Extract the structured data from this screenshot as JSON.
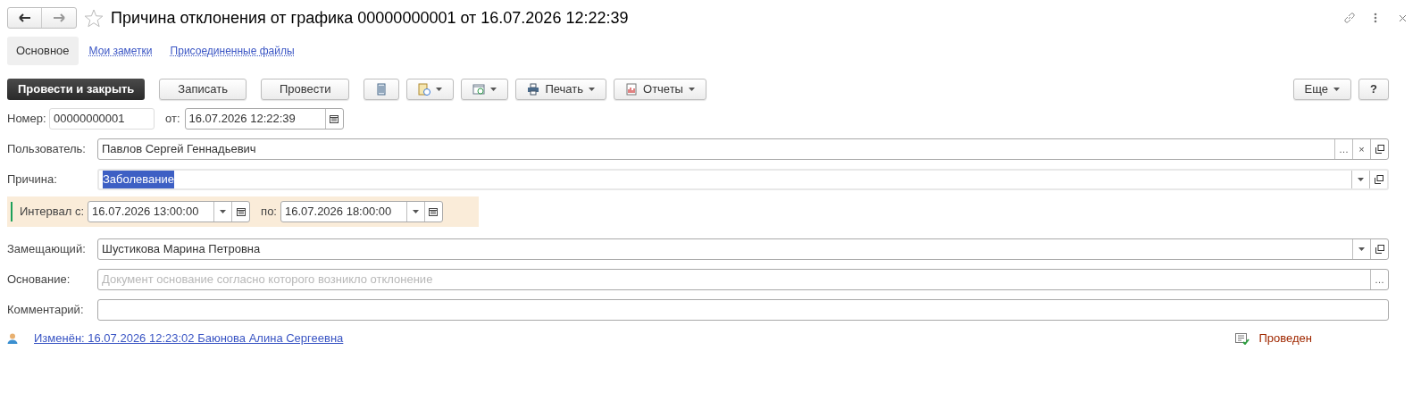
{
  "window": {
    "title": "Причина отклонения от графика 00000000001 от 16.07.2026 12:22:39",
    "favorite": false
  },
  "tabs": [
    {
      "label": "Основное",
      "selected": true
    },
    {
      "label": "Мои заметки",
      "selected": false
    },
    {
      "label": "Присоединенные файлы",
      "selected": false
    }
  ],
  "toolbar": [
    {
      "kind": "primary",
      "label": "Провести и закрыть"
    },
    {
      "kind": "text",
      "label": "Записать"
    },
    {
      "kind": "text",
      "label": "Провести"
    },
    {
      "kind": "list"
    },
    {
      "kind": "document"
    },
    {
      "kind": "schedule"
    },
    {
      "kind": "print",
      "label": "Печать"
    },
    {
      "kind": "reports",
      "label": "Отчеты"
    }
  ],
  "more_button": "Еще",
  "help_button": "?",
  "number": {
    "label": "Номер:",
    "value": "00000000001"
  },
  "date": {
    "label": "от:",
    "value": "16.07.2026 12:22:39"
  },
  "fields": [
    {
      "label": "Пользователь:",
      "value": "Павлов Сергей Геннадьевич",
      "focused": false,
      "select_button": "…",
      "clear_button": "×",
      "open_button": true
    },
    {
      "label": "Причина:",
      "value": "Заболевание",
      "focused": true,
      "dropdown": true,
      "open_button": true
    }
  ],
  "interval": {
    "from_label": "Интервал с:",
    "from": "16.07.2026 13:00:00",
    "to_label": "по:",
    "to": "16.07.2026 18:00:00"
  },
  "fields2": [
    {
      "label": "Замещающий:",
      "value": "Шустикова Марина Петровна",
      "focused": false,
      "dropdown": true,
      "open_button": true
    },
    {
      "label": "Основание:",
      "placeholder": "Документ основание согласно которого возникло отклонение",
      "focused": false,
      "select_button": "…"
    },
    {
      "label": "Комментарий:",
      "focused": false
    }
  ],
  "footer": {
    "changed": "Изменён: 16.07.2026 12:23:02 Баюнова Алина Сергеевна",
    "status": "Проведен"
  }
}
